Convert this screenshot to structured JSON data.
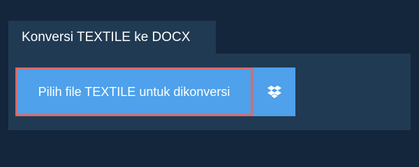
{
  "tab": {
    "title": "Konversi TEXTILE ke DOCX"
  },
  "upload": {
    "select_label": "Pilih file TEXTILE untuk dikonversi",
    "dropbox_icon": "dropbox-icon"
  },
  "colors": {
    "background": "#13263c",
    "panel": "#213a53",
    "button": "#4ea1ea",
    "button_border": "#d96a6a",
    "text": "#ffffff"
  }
}
